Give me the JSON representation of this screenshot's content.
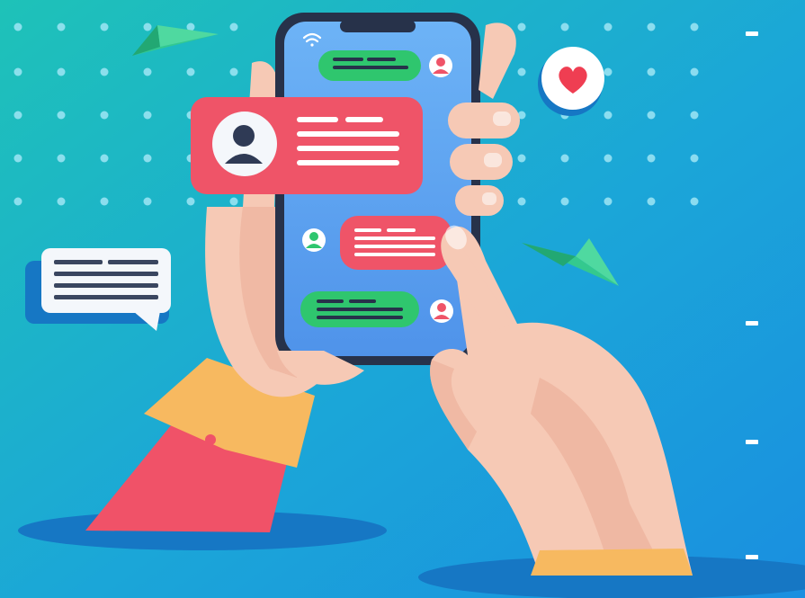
{
  "colors": {
    "bg_top_left": "#1ec2b8",
    "bg_bottom_right": "#1a8fe0",
    "dot": "#9fe6f5",
    "phone_body": "#27324a",
    "phone_screen": "#5aa6f2",
    "bubble_green": "#2fc66e",
    "bubble_red": "#ef5468",
    "bubble_white": "#f4f7fb",
    "heart": "#ef3e52",
    "plane": "#34c98e",
    "skin": "#f6c9b5",
    "skin_shadow": "#e9a993",
    "sleeve": "#f05268",
    "cuff": "#f7b960",
    "shadow": "#1677c4"
  },
  "icons": [
    "wifi-icon",
    "paper-plane-icon",
    "heart-icon",
    "avatar-icon",
    "chat-bubble-icon"
  ]
}
